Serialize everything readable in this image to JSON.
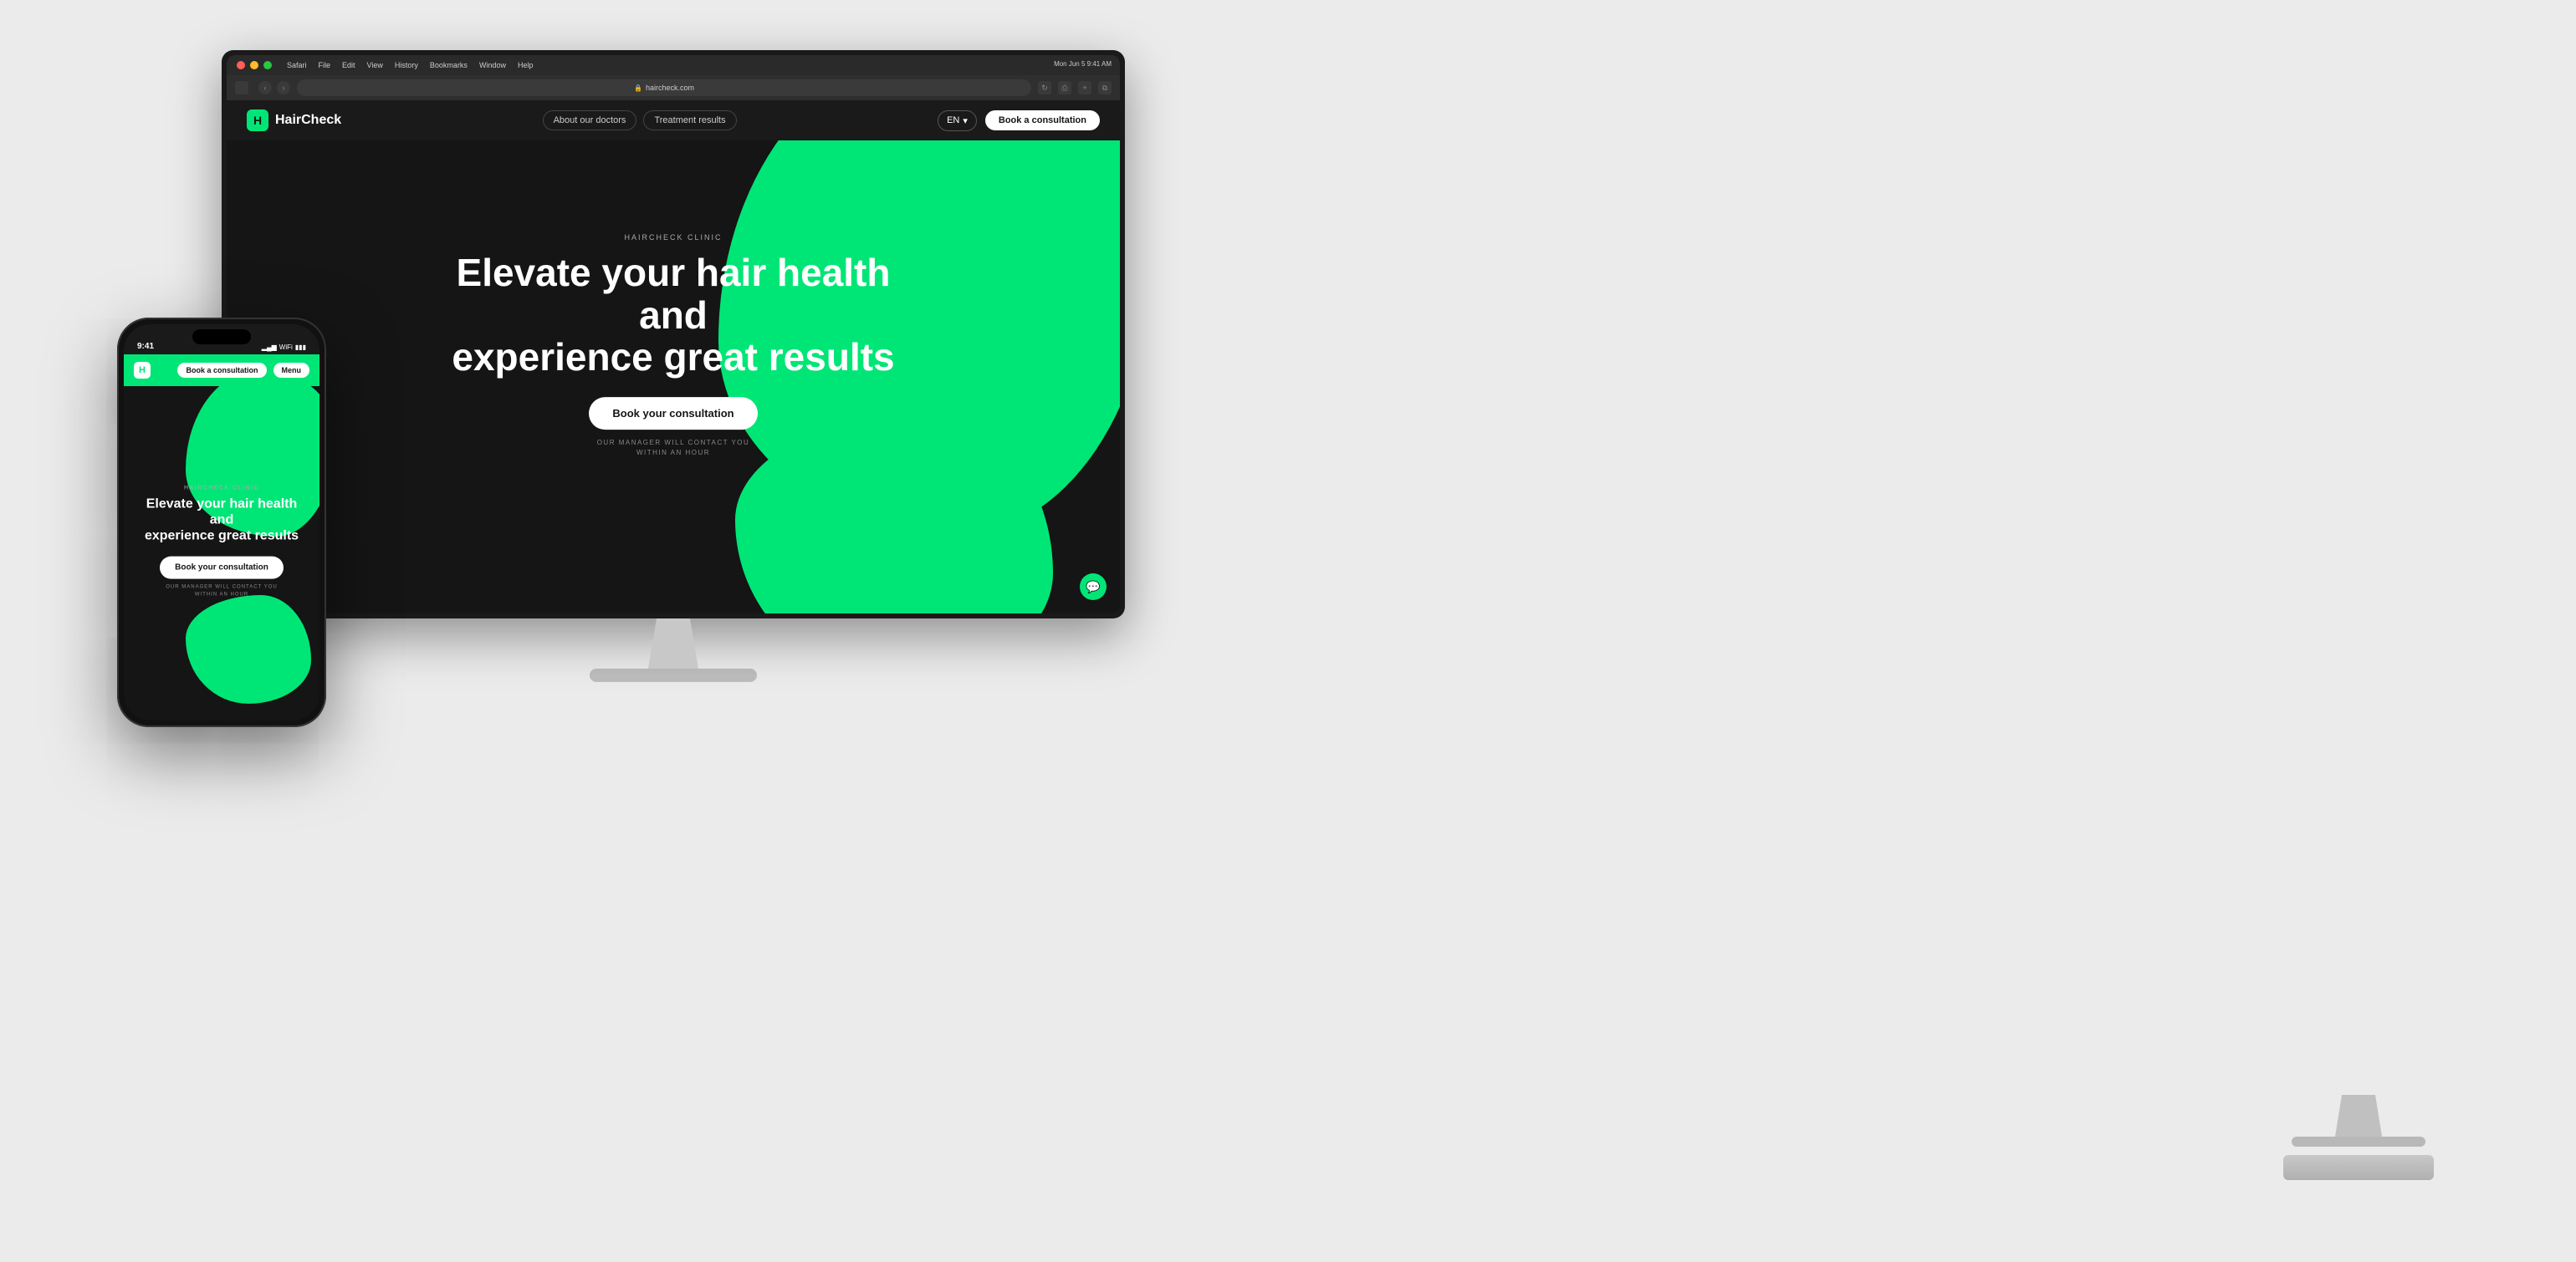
{
  "scene": {
    "background_color": "#ebebeb"
  },
  "monitor": {
    "macos": {
      "menu_items": [
        "Safari",
        "File",
        "Edit",
        "View",
        "History",
        "Bookmarks",
        "Window",
        "Help"
      ],
      "time": "Mon Jun 5  9:41 AM"
    },
    "browser": {
      "url": "haircheck.com",
      "lock_icon": "🔒",
      "reload_icon": "↻"
    },
    "website": {
      "logo_letter": "H",
      "logo_text": "HairCheck",
      "nav_links": [
        "About our doctors",
        "Treatment results"
      ],
      "lang_label": "EN",
      "lang_chevron": "▾",
      "book_cta": "Book a consultation",
      "hero": {
        "clinic_label": "HAIRCHECK CLINIC",
        "heading_line1": "Elevate your hair health and",
        "heading_line2": "experience great results",
        "cta_button": "Book your consultation",
        "subtext_line1": "OUR MANAGER WILL CONTACT YOU",
        "subtext_line2": "WITHIN AN HOUR"
      }
    }
  },
  "phone": {
    "status_bar": {
      "time": "9:41",
      "signal": "▂▄▆",
      "wifi": "WiFi",
      "battery": "▮▮▮"
    },
    "navbar": {
      "logo_letter": "H",
      "book_btn": "Book a consultation",
      "menu_btn": "Menu"
    },
    "hero": {
      "clinic_label": "HAIRCHECK CLINIC",
      "heading_line1": "Elevate your hair health and",
      "heading_line2": "experience great results",
      "cta_button": "Book your consultation",
      "subtext_line1": "OUR MANAGER WILL CONTACT YOU",
      "subtext_line2": "WITHIN AN HOUR"
    }
  },
  "colors": {
    "green": "#00e676",
    "dark": "#151515",
    "white": "#ffffff"
  }
}
